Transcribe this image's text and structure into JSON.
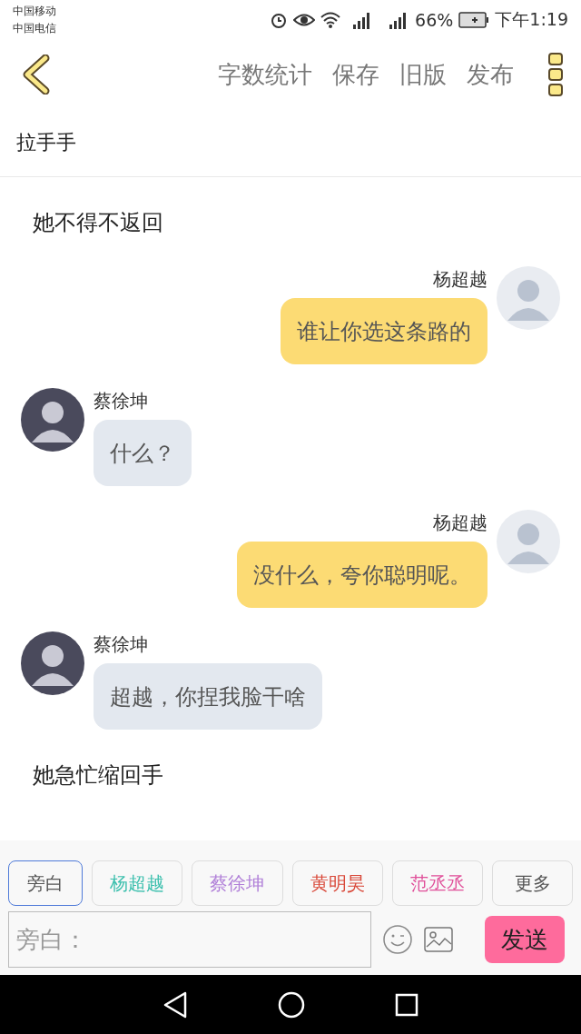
{
  "status_bar": {
    "carriers": [
      "中国移动",
      "中国电信"
    ],
    "battery": "66%",
    "time": "下午1:19"
  },
  "toolbar": {
    "actions": [
      "字数统计",
      "保存",
      "旧版",
      "发布"
    ]
  },
  "story_title": "拉手手",
  "messages": [
    {
      "kind": "narration",
      "text": "她不得不返回"
    },
    {
      "kind": "right",
      "name": "杨超越",
      "text": "谁让你选这条路的"
    },
    {
      "kind": "left",
      "name": "蔡徐坤",
      "text": "什么？"
    },
    {
      "kind": "right",
      "name": "杨超越",
      "text": "没什么，夸你聪明呢。"
    },
    {
      "kind": "left",
      "name": "蔡徐坤",
      "text": "超越，你捏我脸干啥"
    },
    {
      "kind": "narration",
      "text": "她急忙缩回手"
    }
  ],
  "roles": [
    {
      "label": "旁白",
      "color": "#555555",
      "selected": true
    },
    {
      "label": "杨超越",
      "color": "#3bbfad",
      "selected": false
    },
    {
      "label": "蔡徐坤",
      "color": "#b07fd8",
      "selected": false
    },
    {
      "label": "黄明昊",
      "color": "#d9493a",
      "selected": false
    },
    {
      "label": "范丞丞",
      "color": "#e0509a",
      "selected": false
    },
    {
      "label": "更多",
      "color": "#555555",
      "selected": false
    }
  ],
  "composer": {
    "placeholder": "旁白：",
    "send": "发送"
  }
}
